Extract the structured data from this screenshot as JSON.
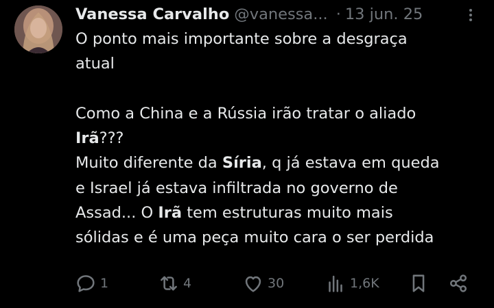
{
  "author": {
    "name": "Vanessa Carvalho",
    "handle": "@vanessa...",
    "separator": "·",
    "date": "13 jun. 25"
  },
  "tweet": {
    "lines": [
      [
        "O ponto mais importante sobre a desgraça"
      ],
      [
        "atual"
      ],
      [
        ""
      ],
      [
        "Como a China e a Rússia irão tratar o aliado"
      ],
      [
        "Irã",
        "???"
      ],
      [
        "Muito diferente da ",
        "Síria",
        ", q já estava em queda"
      ],
      [
        "e Israel já estava infiltrada no governo de"
      ],
      [
        "Assad... O ",
        "Irã",
        " tem estruturas muito mais"
      ],
      [
        "sólidas e é uma peça muito cara o ser perdida"
      ]
    ]
  },
  "actions": {
    "replies": "1",
    "reposts": "4",
    "likes": "30",
    "views": "1,6K"
  },
  "icons": {
    "more": "more-vertical-icon",
    "reply": "reply-icon",
    "repost": "repost-icon",
    "like": "heart-icon",
    "views": "views-bar-chart-icon",
    "bookmark": "bookmark-icon",
    "share": "share-icon"
  },
  "colors": {
    "background": "#000000",
    "text": "#e7e9ea",
    "muted": "#71767b"
  }
}
